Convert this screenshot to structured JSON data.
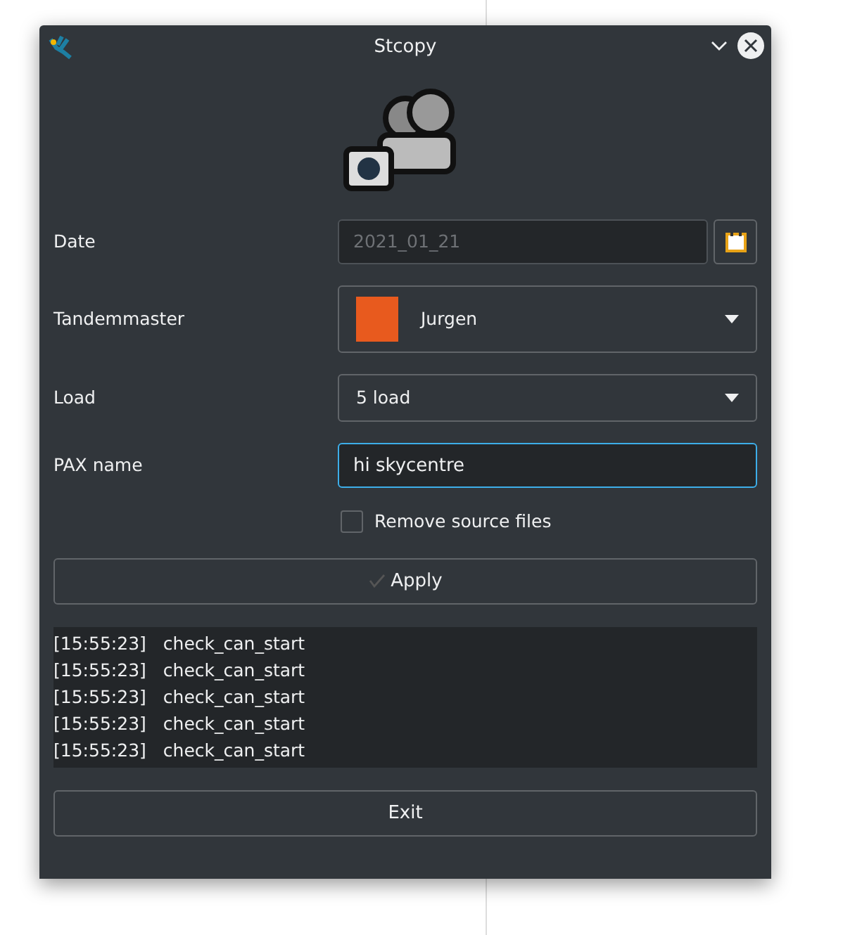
{
  "window": {
    "title": "Stcopy"
  },
  "form": {
    "date": {
      "label": "Date",
      "value": "2021_01_21",
      "disabled": true
    },
    "tandemmaster": {
      "label": "Tandemmaster",
      "value": "Jurgen"
    },
    "load": {
      "label": "Load",
      "value": "5 load"
    },
    "pax_name": {
      "label": "PAX name",
      "value": "hi skycentre"
    },
    "remove_source_files": {
      "label": "Remove source files",
      "checked": false
    }
  },
  "apply_button": "Apply",
  "log": [
    {
      "time": "[15:55:23]",
      "message": "check_can_start"
    },
    {
      "time": "[15:55:23]",
      "message": "check_can_start"
    },
    {
      "time": "[15:55:23]",
      "message": "check_can_start"
    },
    {
      "time": "[15:55:23]",
      "message": "check_can_start"
    },
    {
      "time": "[15:55:23]",
      "message": "check_can_start"
    }
  ],
  "exit_button": "Exit"
}
